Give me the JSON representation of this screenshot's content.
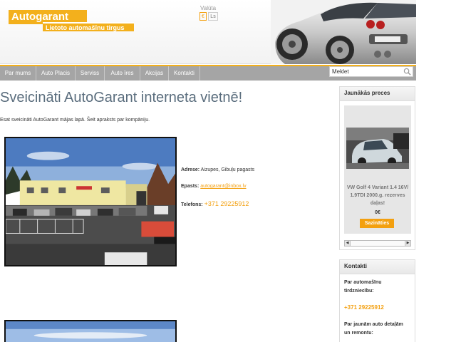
{
  "header": {
    "logo_main": "Autogarant",
    "logo_sub": "Lietoto automašīnu tirgus",
    "valuta_label": "Valūta",
    "currencies": [
      "€",
      "Ls"
    ]
  },
  "nav": {
    "items": [
      "Par mums",
      "Auto Placis",
      "Serviss",
      "Auto īres",
      "Akcijas",
      "Kontakti"
    ]
  },
  "search": {
    "placeholder": "Meklet",
    "value": "Meklet"
  },
  "main": {
    "title": "Sveicināti AutoGarant interneta vietnē!",
    "intro": "Esat sveicināti AutoGarant mājas lapā. Šeit apraksts par kompāniju.",
    "address_label": "Adrese:",
    "address_value": "Aizupes, Gibuļu pagasts",
    "email_label": "Epasts:",
    "email_value": "autogarant@inbox.lv",
    "phone_label": "Telefons:",
    "phone_value": "+371 29225912"
  },
  "sidebar": {
    "latest_title": "Jaunākās preces",
    "product": {
      "title": "VW Golf 4 Variant 1.4 16V/ 1.9TDI 2000.g. rezerves daļas!",
      "price": "0€",
      "button": "Sazināties"
    },
    "contacts_title": "Kontakti",
    "contacts_sales": "Par automašīnu tirdzniecību:",
    "contacts_sales_phone": "+371 29225912",
    "contacts_parts": "Par jaunām auto detaļām un remontu:"
  },
  "colors": {
    "accent": "#f3a010",
    "nav_bg": "#a5a5a5",
    "title": "#5a6d7d"
  }
}
